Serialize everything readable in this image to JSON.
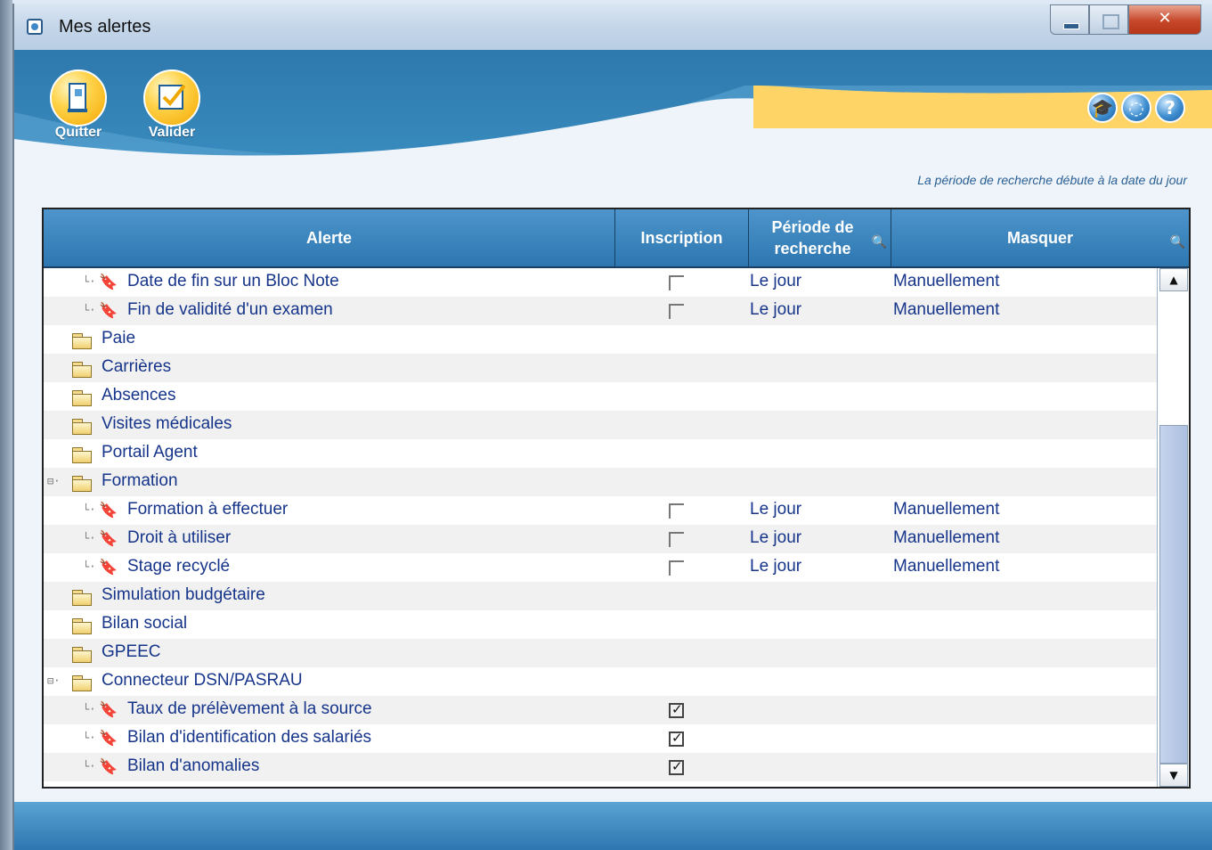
{
  "window": {
    "title": "Mes alertes"
  },
  "toolbar": {
    "quit_label": "Quitter",
    "validate_label": "Valider"
  },
  "help": {
    "icons": [
      "graduation-icon",
      "support-icon",
      "help-icon"
    ],
    "question_glyph": "?"
  },
  "note": "La période de recherche débute à la date du jour",
  "columns": {
    "alert": "Alerte",
    "inscription": "Inscription",
    "period": "Période de recherche",
    "hide": "Masquer"
  },
  "rows": [
    {
      "type": "alert",
      "label": "Date de fin sur un Bloc Note",
      "checked": false,
      "period": "Le jour",
      "hide": "Manuellement"
    },
    {
      "type": "alert",
      "label": "Fin de validité d'un examen",
      "checked": false,
      "period": "Le jour",
      "hide": "Manuellement"
    },
    {
      "type": "folder",
      "label": "Paie",
      "expanded": false
    },
    {
      "type": "folder",
      "label": "Carrières",
      "expanded": false
    },
    {
      "type": "folder",
      "label": "Absences",
      "expanded": false
    },
    {
      "type": "folder",
      "label": "Visites médicales",
      "expanded": false
    },
    {
      "type": "folder",
      "label": "Portail Agent",
      "expanded": false
    },
    {
      "type": "folder",
      "label": "Formation",
      "expanded": true
    },
    {
      "type": "alert",
      "label": "Formation à effectuer",
      "checked": false,
      "period": "Le jour",
      "hide": "Manuellement"
    },
    {
      "type": "alert",
      "label": "Droit à utiliser",
      "checked": false,
      "period": "Le jour",
      "hide": "Manuellement"
    },
    {
      "type": "alert",
      "label": "Stage recyclé",
      "checked": false,
      "period": "Le jour",
      "hide": "Manuellement"
    },
    {
      "type": "folder",
      "label": "Simulation budgétaire",
      "expanded": false
    },
    {
      "type": "folder",
      "label": "Bilan social",
      "expanded": false
    },
    {
      "type": "folder",
      "label": "GPEEC",
      "expanded": false
    },
    {
      "type": "folder",
      "label": "Connecteur DSN/PASRAU",
      "expanded": true
    },
    {
      "type": "alert",
      "label": "Taux de prélèvement à la source",
      "checked": true,
      "period": "",
      "hide": ""
    },
    {
      "type": "alert",
      "label": "Bilan d'identification des salariés",
      "checked": true,
      "period": "",
      "hide": ""
    },
    {
      "type": "alert",
      "label": "Bilan d'anomalies",
      "checked": true,
      "period": "",
      "hide": ""
    }
  ],
  "colors": {
    "header_blue": "#2d76b0",
    "text_blue": "#16358a",
    "accent_yellow": "#ffd34a"
  }
}
